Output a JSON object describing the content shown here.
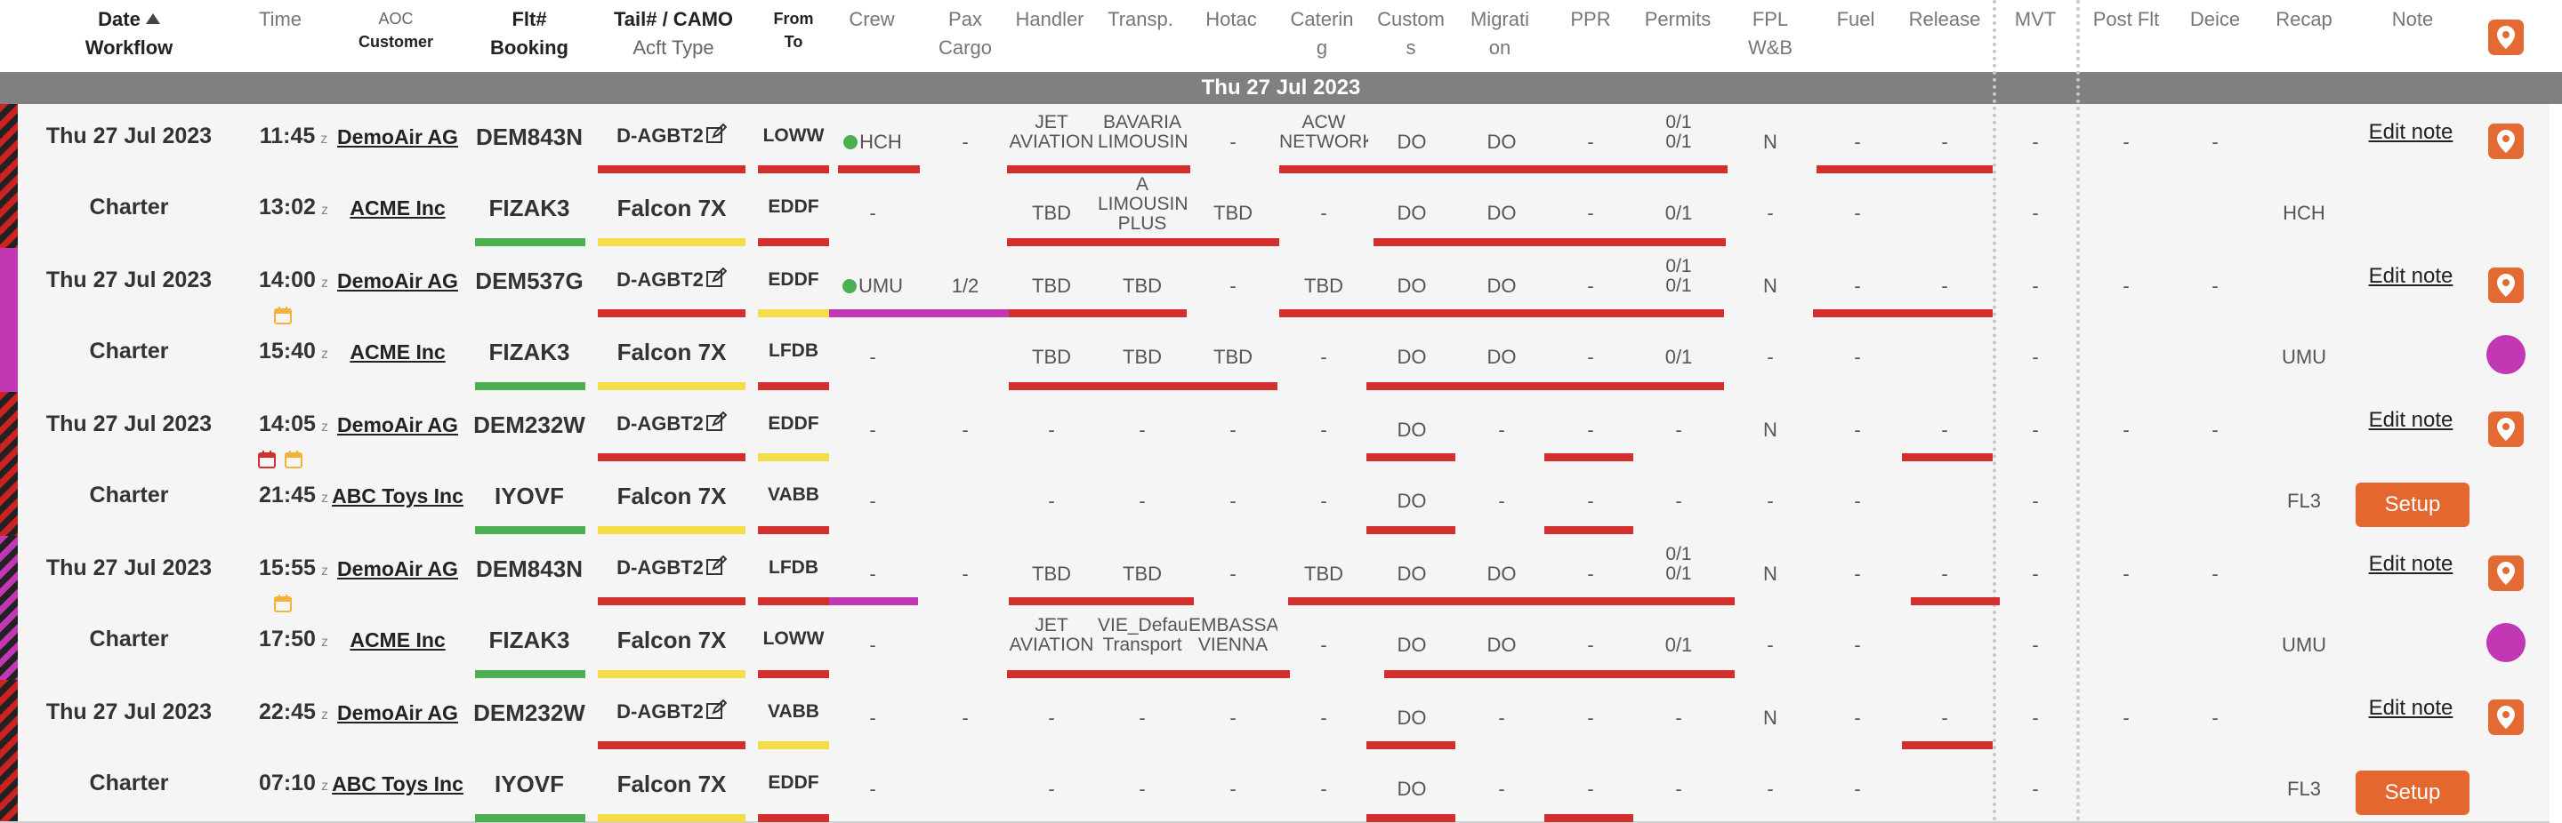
{
  "columns": {
    "date": "Date",
    "workflow": "Workflow",
    "time": "Time",
    "aoc": "AOC",
    "customer": "Customer",
    "flt": "Flt#",
    "booking": "Booking",
    "tail": "Tail# / CAMO",
    "acft_type": "Acft Type",
    "from": "From",
    "to": "To",
    "crew": "Crew",
    "pax": "Pax",
    "cargo": "Cargo",
    "handler": "Handler",
    "transp": "Transp.",
    "hotac": "Hotac",
    "catering_1": "Caterin",
    "catering_2": "g",
    "customs_1": "Custom",
    "customs_2": "s",
    "migration_1": "Migrati",
    "migration_2": "on",
    "ppr": "PPR",
    "permits": "Permits",
    "fpl": "FPL",
    "wb": "W&B",
    "fuel": "Fuel",
    "release": "Release",
    "mvt": "MVT",
    "post_flt": "Post Flt",
    "deice": "Deice",
    "recap": "Recap",
    "note": "Note"
  },
  "day_header": "Thu 27 Jul 2023",
  "colors": {
    "red": "#d32f2f",
    "green": "#4caf50",
    "yellow": "#f5dd4a",
    "magenta": "#c238b4",
    "orange": "#e46a33",
    "day_bar": "#808080"
  },
  "flights": [
    {
      "date": "Thu 27 Jul 2023",
      "workflow": "Charter",
      "time_dep": "11:45",
      "time_arr": "13:02",
      "z": "z",
      "aoc": "DemoAir AG",
      "customer": "ACME Inc",
      "flt": "DEM843N",
      "booking": "FIZAK3",
      "tail": "D-AGBT2",
      "acft_type": "Falcon 7X",
      "from": "LOWW",
      "to": "EDDF",
      "top": {
        "crew": "HCH",
        "crew_dot": true,
        "pax": "-",
        "handler": [
          "JET",
          "AVIATION"
        ],
        "transp": [
          "BAVARIA",
          "LIMOUSINE"
        ],
        "hotac": "-",
        "catering": [
          "ACW",
          "NETWORK"
        ],
        "customs": "DO",
        "migration": "DO",
        "ppr": "-",
        "permits": [
          "0/1",
          "0/1"
        ],
        "fpl": "N",
        "fuel": "-",
        "release": "-",
        "mvt": "-",
        "post_flt": "-",
        "deice": "-"
      },
      "bottom": {
        "crew": "-",
        "handler": "TBD",
        "transp": [
          "A",
          "LIMOUSINE",
          "PLUS"
        ],
        "hotac": "TBD",
        "catering": "-",
        "customs": "DO",
        "migration": "DO",
        "ppr": "-",
        "permits": "0/1",
        "fpl": "-",
        "fuel": "-",
        "mvt": "-",
        "recap": "HCH"
      },
      "note": "Edit note",
      "setup": "",
      "pin": true,
      "circle": false,
      "calendars": []
    },
    {
      "date": "Thu 27 Jul 2023",
      "workflow": "Charter",
      "time_dep": "14:00",
      "time_arr": "15:40",
      "z": "z",
      "aoc": "DemoAir AG",
      "customer": "ACME Inc",
      "flt": "DEM537G",
      "booking": "FIZAK3",
      "tail": "D-AGBT2",
      "acft_type": "Falcon 7X",
      "from": "EDDF",
      "to": "LFDB",
      "top": {
        "crew": "UMU",
        "crew_dot": true,
        "pax": "1/2",
        "handler": "TBD",
        "transp": "TBD",
        "hotac": "-",
        "catering": "TBD",
        "customs": "DO",
        "migration": "DO",
        "ppr": "-",
        "permits": [
          "0/1",
          "0/1"
        ],
        "fpl": "N",
        "fuel": "-",
        "release": "-",
        "mvt": "-",
        "post_flt": "-",
        "deice": "-"
      },
      "bottom": {
        "crew": "-",
        "handler": "TBD",
        "transp": "TBD",
        "hotac": "TBD",
        "catering": "-",
        "customs": "DO",
        "migration": "DO",
        "ppr": "-",
        "permits": "0/1",
        "fpl": "-",
        "fuel": "-",
        "mvt": "-",
        "recap": "UMU"
      },
      "note": "Edit note",
      "setup": "",
      "pin": true,
      "circle": true,
      "calendars": [
        "yellow"
      ]
    },
    {
      "date": "Thu 27 Jul 2023",
      "workflow": "Charter",
      "time_dep": "14:05",
      "time_arr": "21:45",
      "z": "z",
      "aoc": "DemoAir AG",
      "customer": "ABC Toys Inc",
      "flt": "DEM232W",
      "booking": "IYOVF",
      "tail": "D-AGBT2",
      "acft_type": "Falcon 7X",
      "from": "EDDF",
      "to": "VABB",
      "top": {
        "crew": "-",
        "crew_dot": false,
        "pax": "-",
        "handler": "-",
        "transp": "-",
        "hotac": "-",
        "catering": "-",
        "customs": "DO",
        "migration": "-",
        "ppr": "-",
        "permits": "-",
        "fpl": "N",
        "fuel": "-",
        "release": "-",
        "mvt": "-",
        "post_flt": "-",
        "deice": "-"
      },
      "bottom": {
        "crew": "-",
        "handler": "-",
        "transp": "-",
        "hotac": "-",
        "catering": "-",
        "customs": "DO",
        "migration": "-",
        "ppr": "-",
        "permits": "-",
        "fpl": "-",
        "fuel": "-",
        "mvt": "-",
        "recap": "FL3"
      },
      "note": "Edit note",
      "setup": "Setup",
      "pin": true,
      "circle": false,
      "calendars": [
        "red",
        "yellow"
      ]
    },
    {
      "date": "Thu 27 Jul 2023",
      "workflow": "Charter",
      "time_dep": "15:55",
      "time_arr": "17:50",
      "z": "z",
      "aoc": "DemoAir AG",
      "customer": "ACME Inc",
      "flt": "DEM843N",
      "booking": "FIZAK3",
      "tail": "D-AGBT2",
      "acft_type": "Falcon 7X",
      "from": "LFDB",
      "to": "LOWW",
      "top": {
        "crew": "-",
        "crew_dot": false,
        "pax": "-",
        "handler": "TBD",
        "transp": "TBD",
        "hotac": "-",
        "catering": "TBD",
        "customs": "DO",
        "migration": "DO",
        "ppr": "-",
        "permits": [
          "0/1",
          "0/1"
        ],
        "fpl": "N",
        "fuel": "-",
        "release": "-",
        "mvt": "-",
        "post_flt": "-",
        "deice": "-"
      },
      "bottom": {
        "crew": "-",
        "handler": [
          "JET",
          "AVIATION"
        ],
        "transp": [
          "VIE_Default",
          "Transport"
        ],
        "hotac": [
          "EMBASSADOR",
          "VIENNA"
        ],
        "catering": "-",
        "customs": "DO",
        "migration": "DO",
        "ppr": "-",
        "permits": "0/1",
        "fpl": "-",
        "fuel": "-",
        "mvt": "-",
        "recap": "UMU"
      },
      "note": "Edit note",
      "setup": "",
      "pin": true,
      "circle": true,
      "calendars": [
        "yellow"
      ]
    },
    {
      "date": "Thu 27 Jul 2023",
      "workflow": "Charter",
      "time_dep": "22:45",
      "time_arr": "07:10",
      "z": "z",
      "aoc": "DemoAir AG",
      "customer": "ABC Toys Inc",
      "flt": "DEM232W",
      "booking": "IYOVF",
      "tail": "D-AGBT2",
      "acft_type": "Falcon 7X",
      "from": "VABB",
      "to": "EDDF",
      "top": {
        "crew": "-",
        "crew_dot": false,
        "pax": "-",
        "handler": "-",
        "transp": "-",
        "hotac": "-",
        "catering": "-",
        "customs": "DO",
        "migration": "-",
        "ppr": "-",
        "permits": "-",
        "fpl": "N",
        "fuel": "-",
        "release": "-",
        "mvt": "-",
        "post_flt": "-",
        "deice": "-"
      },
      "bottom": {
        "crew": "-",
        "handler": "-",
        "transp": "-",
        "hotac": "-",
        "catering": "-",
        "customs": "DO",
        "migration": "-",
        "ppr": "-",
        "permits": "-",
        "fpl": "-",
        "fuel": "-",
        "mvt": "-",
        "recap": "FL3"
      },
      "note": "Edit note",
      "setup": "Setup",
      "pin": true,
      "circle": false,
      "calendars": []
    }
  ]
}
